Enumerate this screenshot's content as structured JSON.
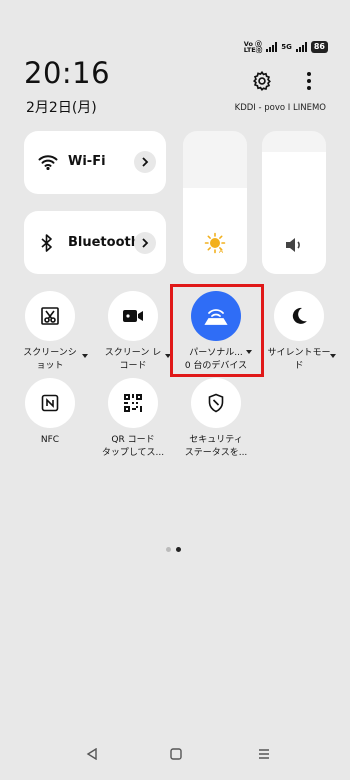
{
  "status": {
    "net_top": "Vo ⓪",
    "net_bottom": "LTE⓪",
    "net_5g": "5G",
    "battery": "86"
  },
  "header": {
    "time": "20:16",
    "date": "2月2日(月)",
    "carrier": "KDDI - povo I LINEMO"
  },
  "tiles": {
    "wifi": "Wi-Fi",
    "bluetooth": "Bluetooth"
  },
  "sliders": {
    "brightness_level": 0.6,
    "volume_level": 0.85
  },
  "toggles": [
    {
      "label": "スクリーンショット"
    },
    {
      "label": "スクリーン レコード"
    },
    {
      "label": "パーソナル...",
      "sub": "0 台のデバイス"
    },
    {
      "label": "サイレントモード"
    },
    {
      "label": "NFC"
    },
    {
      "label": "QR コード",
      "sub": "タップしてス..."
    },
    {
      "label": "セキュリティ",
      "sub": "ステータスを..."
    }
  ],
  "colors": {
    "accent": "#2f6df6",
    "highlight": "#e01818",
    "background": "#e8e8e8"
  }
}
